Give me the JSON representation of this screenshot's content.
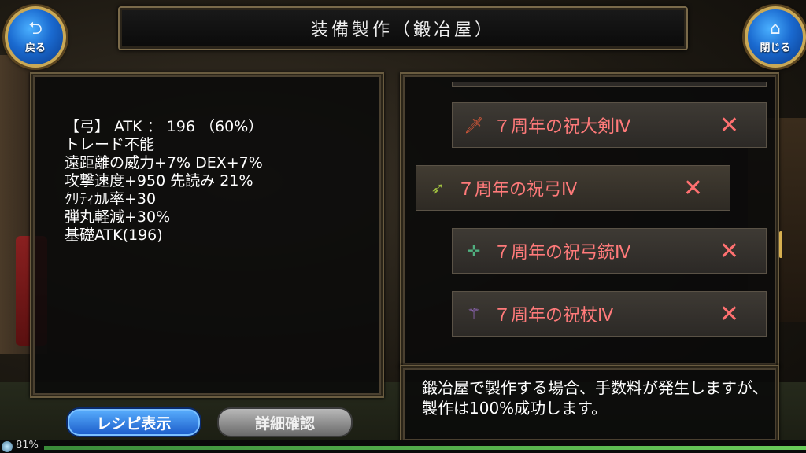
{
  "header": {
    "title": "装備製作（鍛冶屋）",
    "back_label": "戻る",
    "back_icon": "back-arrow-icon",
    "close_label": "閉じる",
    "close_icon": "home-icon"
  },
  "stats": {
    "lines": [
      "【弓】 ATK ： 196 （60%）",
      "トレード不能",
      "遠距離の威力+7% DEX+7%",
      "攻撃速度+950 先読み 21%",
      "ｸﾘﾃｨｶﾙ率+30",
      "弾丸軽減+30%",
      "基礎ATK(196)"
    ]
  },
  "recipe_list": {
    "items": [
      {
        "name": "７周年の祝大剣Ⅳ",
        "icon": "greatsword-icon",
        "icon_color": "#e05a3a",
        "selected": false,
        "remove": "✕"
      },
      {
        "name": "７周年の祝弓Ⅳ",
        "icon": "bow-icon",
        "icon_color": "#a0c040",
        "selected": true,
        "remove": "✕"
      },
      {
        "name": "７周年の祝弓銃Ⅳ",
        "icon": "crossbow-icon",
        "icon_color": "#50b080",
        "selected": false,
        "remove": "✕"
      },
      {
        "name": "７周年の祝杖Ⅳ",
        "icon": "staff-icon",
        "icon_color": "#a070d0",
        "selected": false,
        "remove": "✕"
      }
    ]
  },
  "message": "鍛冶屋で製作する場合、手数料が発生しますが、製作は100%成功します。",
  "buttons": {
    "recipe": "レシピ表示",
    "detail": "詳細確認"
  },
  "status": {
    "battery": "81%"
  }
}
